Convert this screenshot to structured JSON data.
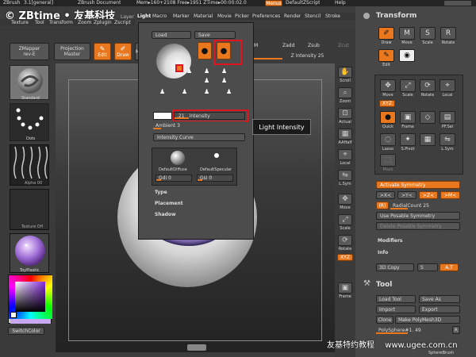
{
  "title_bar": {
    "app": "ZBrush",
    "version": "3.1[general]",
    "doc": "ZBrush Document",
    "mem": "Mem▸160+2108 Free▸1951 ZTime▸00:00:02.0",
    "menus_btn": "Menus",
    "script_btn": "DefaultZScript",
    "help_btn": "Help"
  },
  "watermark": {
    "brand": "© ZBtime • 友基科技",
    "bottom": "友基特约教程",
    "site": "www.ugee.com.cn"
  },
  "menubar": [
    "Texture",
    "Tool",
    "Transform",
    "Zoom",
    "Zplugin",
    "Zscript"
  ],
  "menubar_right": [
    "Light",
    "Macro",
    "Marker",
    "Material",
    "Movie",
    "Picker",
    "Preferences",
    "Render",
    "Stencil",
    "Stroke"
  ],
  "menubar_layer": "Layer",
  "top_left": {
    "zmapper": "ZMapper",
    "zmapper_sub": "rev-E",
    "projection": "Projection",
    "projection_sub": "Master",
    "edit": "Edit",
    "draw": "Draw",
    "move_short": "Mo"
  },
  "top_right_controls": {
    "m_label": "M",
    "zadd": "Zadd",
    "zsub": "Zsub",
    "zcut": "Zcut",
    "z_intensity": "Z Intensity 25"
  },
  "left_shelf": [
    {
      "label": "Standard"
    },
    {
      "label": "Dots"
    },
    {
      "label": "Alpha 00"
    },
    {
      "label": "Texture Off"
    },
    {
      "label": "ToyPlastic"
    }
  ],
  "switch_color": "SwitchColor",
  "light_panel": {
    "load": "Load",
    "save": "Save",
    "intensity_value": ".21",
    "intensity_label": "Intensity",
    "ambient": "Ambient 3",
    "intensity_curve": "Intensity Curve",
    "diffuse": "DefaultDiffuse",
    "specular": "DefaultSpecular",
    "gdi": "Gdi 0",
    "gsi": "Gsi 0",
    "type": "Type",
    "placement": "Placement",
    "shadow": "Shadow"
  },
  "tooltip": "Light Intensity",
  "right_strip": [
    "Scroll",
    "Zoom",
    "Actual",
    "AAHalf",
    "Local",
    "L.Sym",
    "Move",
    "Scale",
    "Rotate",
    "XYZ",
    "Frame"
  ],
  "transform_panel": {
    "title": "Transform",
    "buttons_row1": [
      "Draw",
      "Move",
      "Scale",
      "Rotate"
    ],
    "buttons_row2": [
      "Edit",
      ""
    ],
    "buttons_row3": [
      "Move",
      "Scale",
      "Rotate",
      "Local"
    ],
    "xyz": "XYZ",
    "buttons_row4": [
      "Quick",
      "Frame",
      "",
      "PF.Sel"
    ],
    "buttons_row5": [
      "Lasso",
      "S.Pivot",
      "",
      "L.Sym"
    ],
    "row6": "Mask",
    "activate_symmetry": "Activate Symmetry",
    "axes": [
      ">X<",
      ">Y<",
      ">Z<",
      ">M<"
    ],
    "r_label": "(R)",
    "radial_count": "RadialCount 25",
    "use_posable": "Use Posable Symmetry",
    "delete_posable": "Delete Posable Symmetry",
    "modifiers": "Modifiers",
    "info": "Info",
    "copy_3d": "3D Copy",
    "s_label": "S",
    "a_label": "A.T"
  },
  "tool_panel": {
    "title": "Tool",
    "load_tool": "Load Tool",
    "save_as": "Save As",
    "import": "Import",
    "export": "Export",
    "clone": "Clone",
    "make_polymesh": "Make PolyMesh3D",
    "polysphere": "PolySphere#1. 49",
    "r_label": "R",
    "sphere_label": "SphereBrush"
  },
  "colors": {
    "accent": "#e8771e",
    "highlight_red": "#e0141e",
    "bg": "#3c3c3c",
    "canvas": "#222222"
  }
}
